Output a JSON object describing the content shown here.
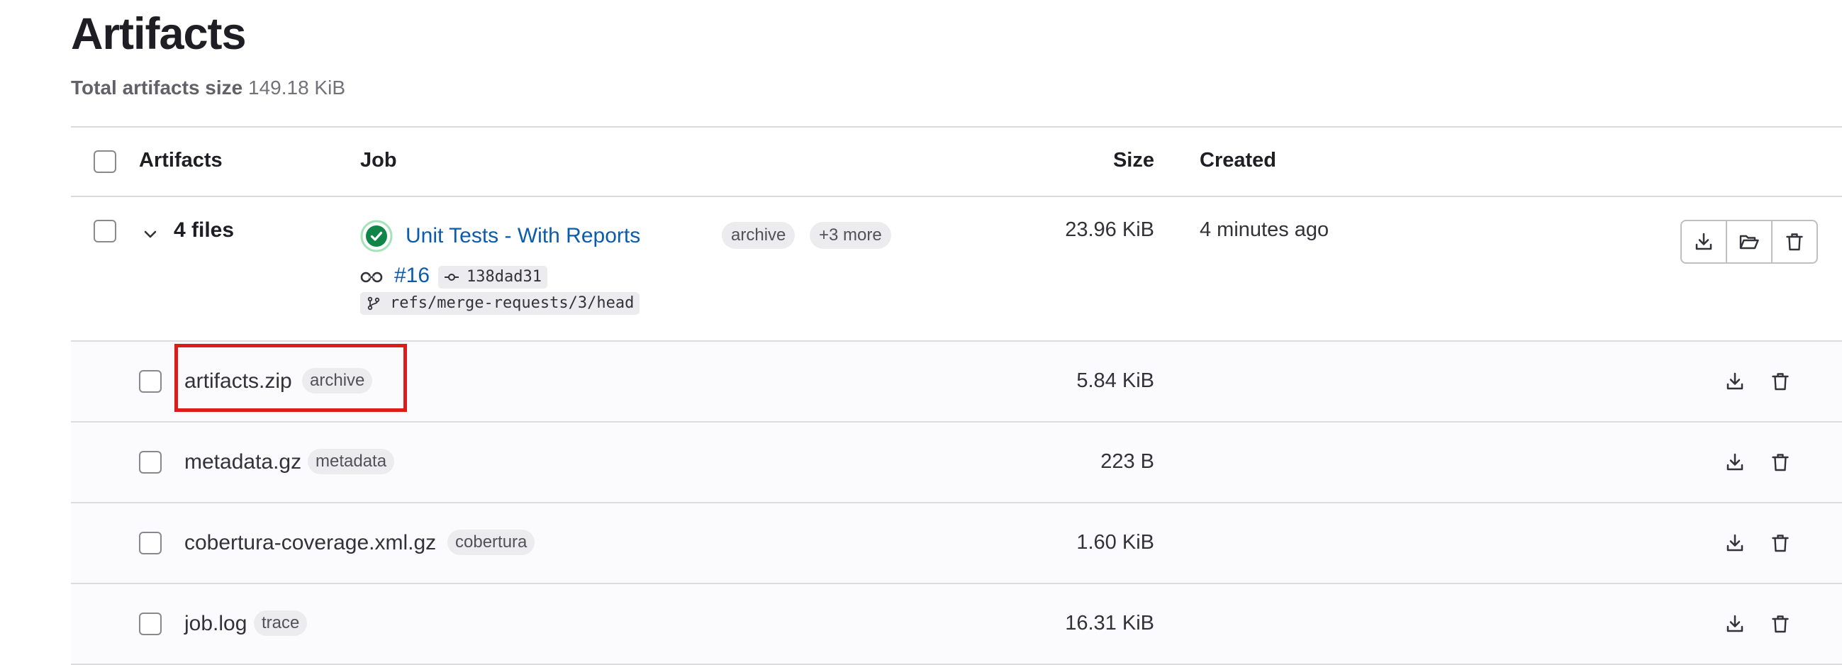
{
  "page": {
    "title": "Artifacts",
    "total_label": "Total artifacts size",
    "total_value": "149.18 KiB"
  },
  "table": {
    "headers": {
      "artifacts": "Artifacts",
      "job": "Job",
      "size": "Size",
      "created": "Created"
    },
    "group": {
      "files_count": "4 files",
      "job_name": "Unit Tests - With Reports",
      "job_badge": "archive",
      "more_badge": "+3 more",
      "pipeline": "#16",
      "commit": "138dad31",
      "ref": "refs/merge-requests/3/head",
      "size": "23.96 KiB",
      "created": "4 minutes ago"
    },
    "files": [
      {
        "name": "artifacts.zip",
        "type": "archive",
        "size": "5.84 KiB"
      },
      {
        "name": "metadata.gz",
        "type": "metadata",
        "size": "223 B"
      },
      {
        "name": "cobertura-coverage.xml.gz",
        "type": "cobertura",
        "size": "1.60 KiB"
      },
      {
        "name": "job.log",
        "type": "trace",
        "size": "16.31 KiB"
      }
    ]
  },
  "icons": {
    "status": "status-success-icon",
    "pipeline": "pipeline-icon",
    "commit": "commit-icon",
    "branch": "branch-icon",
    "download": "download-icon",
    "browse": "folder-open-icon",
    "delete": "trash-icon",
    "chevron": "chevron-down-icon"
  },
  "colors": {
    "link": "#0b5cad",
    "success": "#108548",
    "highlight": "#dd1b1b"
  }
}
